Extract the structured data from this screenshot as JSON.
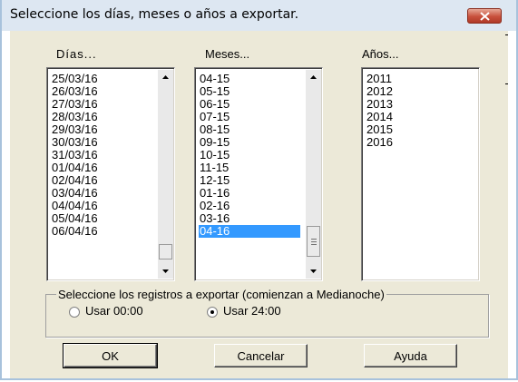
{
  "window": {
    "title": "Seleccione los días, meses o años a exportar."
  },
  "columns": {
    "days": "Días...",
    "months": "Meses...",
    "years": "Años..."
  },
  "days": [
    "25/03/16",
    "26/03/16",
    "27/03/16",
    "28/03/16",
    "29/03/16",
    "30/03/16",
    "31/03/16",
    "01/04/16",
    "02/04/16",
    "03/04/16",
    "04/04/16",
    "05/04/16",
    "06/04/16"
  ],
  "months": [
    "04-15",
    "05-15",
    "06-15",
    "07-15",
    "08-15",
    "09-15",
    "10-15",
    "11-15",
    "12-15",
    "01-16",
    "02-16",
    "03-16",
    "04-16"
  ],
  "months_selected": "04-16",
  "years": [
    "2011",
    "2012",
    "2013",
    "2014",
    "2015",
    "2016"
  ],
  "group": {
    "legend": "Seleccione los registros a exportar (comienzan a Medianoche)",
    "option_00": "Usar 00:00",
    "option_24": "Usar 24:00",
    "selected": "Usar 24:00"
  },
  "buttons": {
    "ok": "OK",
    "cancel": "Cancelar",
    "help": "Ayuda"
  },
  "colors": {
    "selection": "#3399ff",
    "dialog_face": "#ece9d8",
    "titlebar": "#dde7f2",
    "close": "#c8503c"
  }
}
